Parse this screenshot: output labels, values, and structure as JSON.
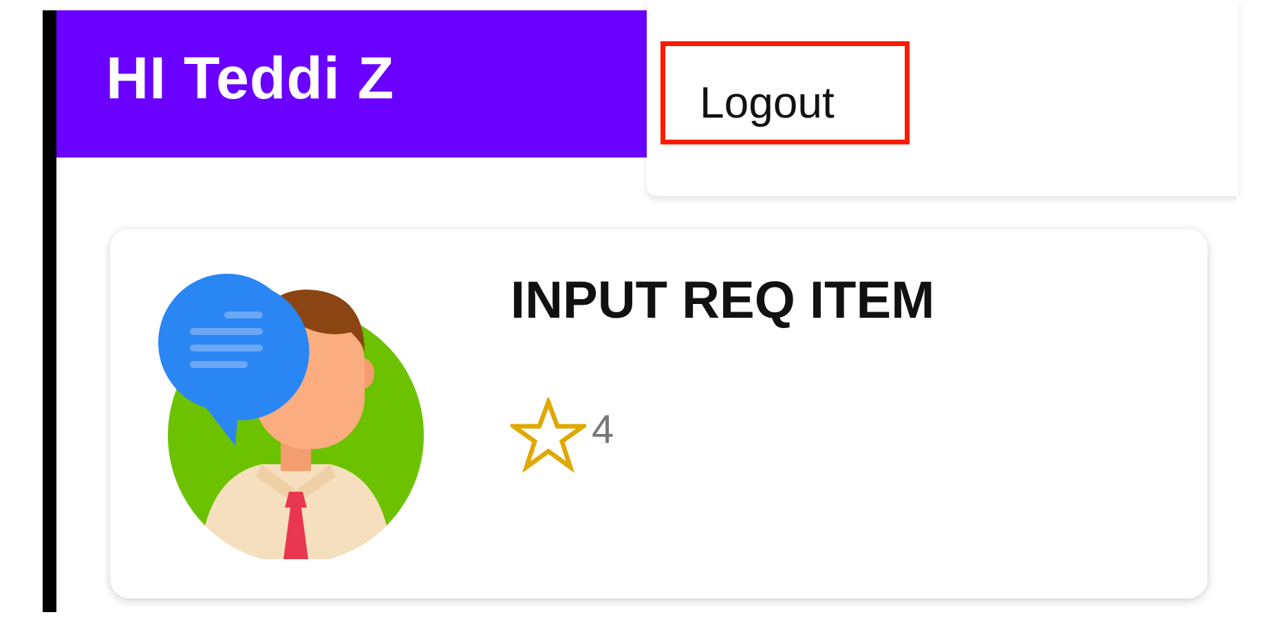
{
  "header": {
    "greeting": "HI Teddi Z",
    "background_color": "#6a00ff"
  },
  "menu": {
    "logout_label": "Logout",
    "highlight_color": "#ff1a00"
  },
  "item": {
    "title": "INPUT REQ ITEM",
    "avatar_icon": "person-with-chat-bubble-icon",
    "rating_icon": "star-outline-icon",
    "rating": "4",
    "star_color": "#e0a800"
  }
}
